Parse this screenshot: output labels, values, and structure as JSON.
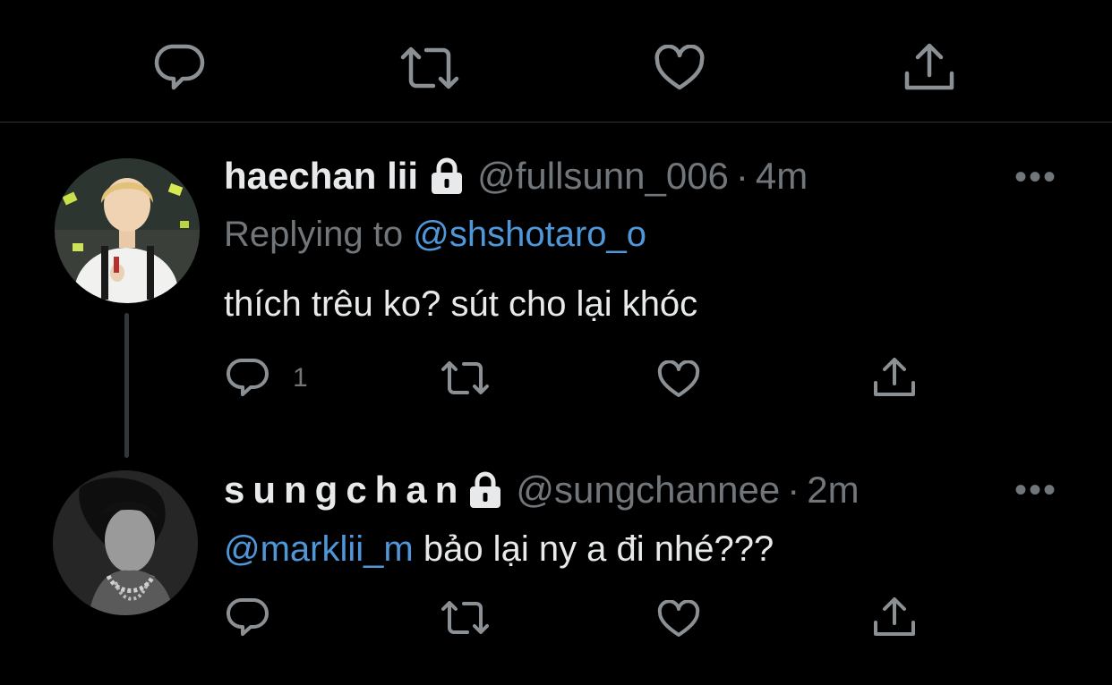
{
  "colors": {
    "background": "#000000",
    "text": "#e7e9ea",
    "muted": "#71767b",
    "link": "#4f97d9",
    "divider": "#2f3336"
  },
  "top_actions": {
    "icons": [
      "reply-icon",
      "retweet-icon",
      "like-icon",
      "share-icon"
    ]
  },
  "tweets": [
    {
      "display_name": "haechan lii",
      "handle": "@fullsunn_006",
      "separator": "·",
      "time": "4m",
      "protected_icon": "lock-icon",
      "replying_prefix": "Replying to",
      "replying_to": "@shshotaro_o",
      "text": "thích trêu ko? sút cho lại khóc",
      "reply_count": "1",
      "more": "•••"
    },
    {
      "display_name": "sungchan",
      "handle": "@sungchannee",
      "separator": "·",
      "time": "2m",
      "protected_icon": "lock-icon",
      "mention": "@marklii_m",
      "text": " bảo lại ny a đi nhé???",
      "more": "•••"
    }
  ]
}
